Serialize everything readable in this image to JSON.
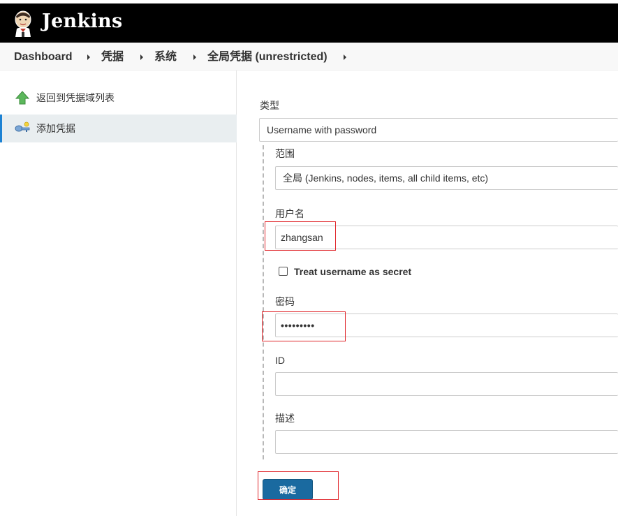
{
  "app": {
    "brand": "Jenkins",
    "logo_icon": "jenkins-butler-icon"
  },
  "breadcrumb": {
    "items": [
      {
        "label": "Dashboard"
      },
      {
        "label": "凭据"
      },
      {
        "label": "系统"
      },
      {
        "label": "全局凭据 (unrestricted)"
      }
    ]
  },
  "sidebar": {
    "items": [
      {
        "label": "返回到凭据域列表",
        "icon": "green-up-arrow-icon",
        "active": false
      },
      {
        "label": "添加凭据",
        "icon": "key-icon",
        "active": true
      }
    ]
  },
  "form": {
    "kind_label": "类型",
    "kind_value": "Username with password",
    "scope_label": "范围",
    "scope_value": "全局 (Jenkins, nodes, items, all child items, etc)",
    "username_label": "用户名",
    "username_value": "zhangsan",
    "username_secret_label": "Treat username as secret",
    "password_label": "密码",
    "password_value": "•••••••••",
    "id_label": "ID",
    "id_value": "",
    "description_label": "描述",
    "description_value": "",
    "submit_label": "确定"
  },
  "colors": {
    "header_bg": "#000000",
    "breadcrumb_bg": "#f8f8f8",
    "active_item_bg": "#e9eef0",
    "active_item_border": "#1d82d3",
    "button_bg": "#1a6aa0",
    "highlight_border": "#e0262b"
  }
}
